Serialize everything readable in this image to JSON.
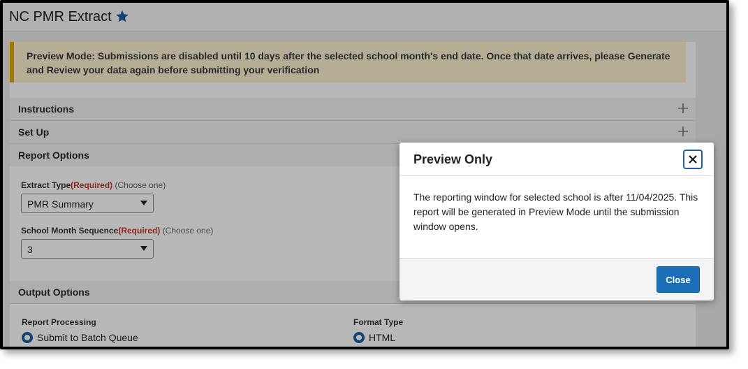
{
  "page": {
    "title": "NC PMR Extract"
  },
  "banner": {
    "text": "Preview Mode: Submissions are disabled until 10 days after the selected school month's end date. Once that date arrives, please Generate and Review your data again before submitting your verification"
  },
  "panels": {
    "instructions": "Instructions",
    "setup": "Set Up",
    "report_options": "Report Options",
    "output_options": "Output Options"
  },
  "report_options": {
    "extract_type": {
      "label": "Extract Type",
      "required": "(Required)",
      "hint": "(Choose one)",
      "value": "PMR Summary"
    },
    "school_month": {
      "label": "School Month Sequence",
      "required": "(Required)",
      "hint": "(Choose one)",
      "value": "3"
    }
  },
  "output_options": {
    "report_processing": {
      "label": "Report Processing",
      "selected": "Submit to Batch Queue"
    },
    "format_type": {
      "label": "Format Type",
      "selected": "HTML"
    }
  },
  "modal": {
    "title": "Preview Only",
    "message": "The reporting window for selected school is after 11/04/2025. This report will be generated in Preview Mode until the submission window opens.",
    "close_label": "Close"
  },
  "colors": {
    "accent": "#1a6fb8",
    "required": "#c0392b",
    "banner_bg": "#fdf0cf",
    "banner_border": "#e0a800"
  }
}
